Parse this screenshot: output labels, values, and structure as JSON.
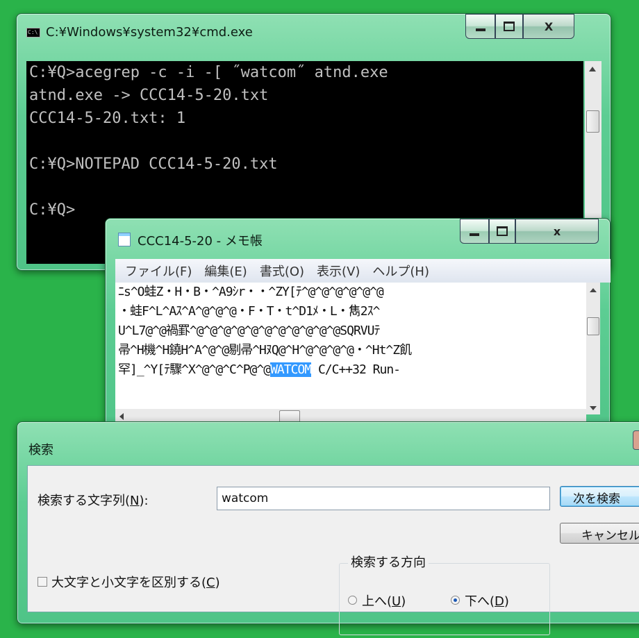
{
  "cmd": {
    "title": "C:¥Windows¥system32¥cmd.exe",
    "lines": [
      "C:¥Q>acegrep -c -i -[ ˝watcom˝ atnd.exe",
      "atnd.exe -> CCC14-5-20.txt",
      "CCC14-5-20.txt: 1",
      "",
      "C:¥Q>NOTEPAD CCC14-5-20.txt",
      "",
      "C:¥Q>"
    ],
    "buttons": {
      "minimize": "_",
      "maximize": "□",
      "close": "X"
    }
  },
  "notepad": {
    "title": "CCC14-5-20 - メモ帳",
    "menu": [
      "ファイル(F)",
      "編集(E)",
      "書式(O)",
      "表示(V)",
      "ヘルプ(H)"
    ],
    "lines": [
      "ﾆs^O蛙Z・H・B・^A9ｼr・・^ZY[ﾃ^@^@^@^@^@^@",
      "・蛙F^L^Aｽ^A^@^@^@・F・T・t^D1ﾒ・L・雋2ｽ^",
      "U^L7@^@禍罫^@^@^@^@^@^@^@^@^@^@^@SQRVUﾃ",
      "帚^H機^H鐃H^A^@^@剔帚^HﾇQ@^H^@^@^@^@・^Ht^Z飢",
      "罕]_^Y[ﾃ驟^X^@^@^C^P@^@"
    ],
    "highlight": "WATCOM",
    "after_highlight": " C/C++32 Run-"
  },
  "find": {
    "title": "検索",
    "label_find_what": "検索する文字列(",
    "label_find_what_key": "N",
    "label_find_what_end": "):",
    "search_value": "watcom",
    "find_next": "次を検索",
    "cancel": "キャンセル",
    "direction_label": "検索する方向",
    "up_label": "上へ(",
    "up_key": "U",
    "down_label": "下へ(",
    "down_key": "D",
    "close_paren": ")",
    "match_case_label": "大文字と小文字を区別する(",
    "match_case_key": "C",
    "direction_selected": "down",
    "match_case_checked": false
  }
}
